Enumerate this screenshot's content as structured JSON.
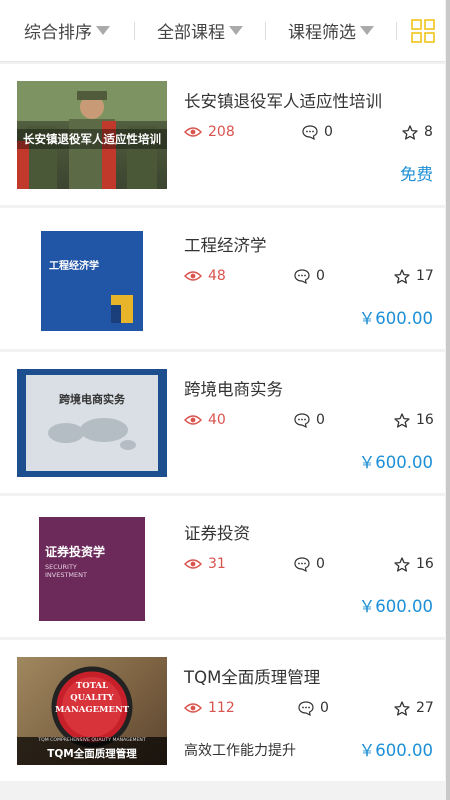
{
  "filters": [
    {
      "label": "综合排序"
    },
    {
      "label": "全部课程"
    },
    {
      "label": "课程筛选"
    }
  ],
  "courses": [
    {
      "title": "长安镇退役军人适应性培训",
      "views": "208",
      "comments": "0",
      "stars": "8",
      "price": "免费",
      "thumb_caption": "长安镇退役军人适应性培训",
      "subtitle": ""
    },
    {
      "title": "工程经济学",
      "views": "48",
      "comments": "0",
      "stars": "17",
      "price": "￥600.00",
      "thumb_caption": "工程经济学",
      "subtitle": ""
    },
    {
      "title": "跨境电商实务",
      "views": "40",
      "comments": "0",
      "stars": "16",
      "price": "￥600.00",
      "thumb_caption": "跨境电商实务",
      "subtitle": ""
    },
    {
      "title": "证券投资",
      "views": "31",
      "comments": "0",
      "stars": "16",
      "price": "￥600.00",
      "thumb_caption": "证券投资学",
      "subtitle": ""
    },
    {
      "title": "TQM全面质理管理",
      "views": "112",
      "comments": "0",
      "stars": "27",
      "price": "￥600.00",
      "thumb_caption": "TQM全面质理管理",
      "subtitle": "高效工作能力提升"
    }
  ],
  "thumb_texts": {
    "c1": "SECURITY\nINVESTMENT",
    "c4a": "TOTAL",
    "c4b": "QUALITY",
    "c4c": "MANAGEMENT",
    "c4d": "TQM COMPREHENSIVE QUALITY MANAGEMENT"
  },
  "colors": {
    "views": "#d9534f",
    "price": "#1e8fd6",
    "grid_icon": "#f0c419"
  }
}
